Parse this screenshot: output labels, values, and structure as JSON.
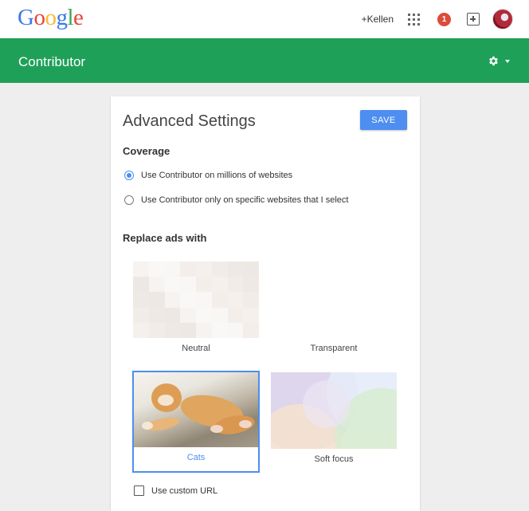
{
  "google_bar": {
    "logo_letters": [
      {
        "char": "G",
        "color": "#3b78e7"
      },
      {
        "char": "o",
        "color": "#e8453c"
      },
      {
        "char": "o",
        "color": "#f9bb2d"
      },
      {
        "char": "g",
        "color": "#3b78e7"
      },
      {
        "char": "l",
        "color": "#3aa757"
      },
      {
        "char": "e",
        "color": "#e8453c"
      }
    ],
    "profile_link": "+Kellen",
    "apps_icon": "apps-grid-icon",
    "notification_count": "1",
    "share_icon": "plus-box-icon",
    "avatar_icon": "avatar"
  },
  "header": {
    "title": "Contributor",
    "accent_color": "#1fa058",
    "settings_icon": "gear-icon"
  },
  "settings": {
    "title": "Advanced Settings",
    "save_label": "SAVE",
    "coverage": {
      "heading": "Coverage",
      "options": [
        {
          "label": "Use Contributor on millions of websites",
          "selected": true
        },
        {
          "label": "Use Contributor only on specific websites that I select",
          "selected": false
        }
      ]
    },
    "replace": {
      "heading": "Replace ads with",
      "tiles": [
        {
          "label": "Neutral",
          "selected": false
        },
        {
          "label": "Transparent",
          "selected": false
        },
        {
          "label": "Cats",
          "selected": true
        },
        {
          "label": "Soft focus",
          "selected": false
        }
      ]
    },
    "custom_url": {
      "label": "Use custom URL",
      "checked": false
    }
  }
}
